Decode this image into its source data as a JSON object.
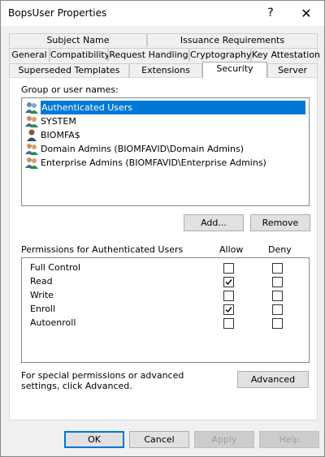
{
  "window": {
    "title": "BopsUser Properties",
    "help_glyph": "?",
    "close_glyph": "✕"
  },
  "tabs": {
    "row1": [
      "Subject Name",
      "Issuance Requirements"
    ],
    "row2": [
      "General",
      "Compatibility",
      "Request Handling",
      "Cryptography",
      "Key Attestation"
    ],
    "row3": [
      "Superseded Templates",
      "Extensions",
      "Security",
      "Server"
    ],
    "active": "Security"
  },
  "security": {
    "group_label": "Group or user names:",
    "users": [
      {
        "name": "Authenticated Users",
        "icon": "group-users-icon",
        "selected": true
      },
      {
        "name": "SYSTEM",
        "icon": "group-users-icon",
        "selected": false
      },
      {
        "name": "BIOMFA$",
        "icon": "user-icon",
        "selected": false
      },
      {
        "name": "Domain Admins (BIOMFAVID\\Domain Admins)",
        "icon": "group-users-icon",
        "selected": false
      },
      {
        "name": "Enterprise Admins (BIOMFAVID\\Enterprise Admins)",
        "icon": "group-users-icon",
        "selected": false
      }
    ],
    "add_label": "Add...",
    "remove_label": "Remove",
    "permissions_label": "Permissions for Authenticated Users",
    "allow_label": "Allow",
    "deny_label": "Deny",
    "permissions": [
      {
        "name": "Full Control",
        "allow": false,
        "deny": false
      },
      {
        "name": "Read",
        "allow": true,
        "deny": false
      },
      {
        "name": "Write",
        "allow": false,
        "deny": false
      },
      {
        "name": "Enroll",
        "allow": true,
        "deny": false
      },
      {
        "name": "Autoenroll",
        "allow": false,
        "deny": false
      }
    ],
    "advanced_text": "For special permissions or advanced settings, click Advanced.",
    "advanced_label": "Advanced"
  },
  "footer": {
    "ok_label": "OK",
    "cancel_label": "Cancel",
    "apply_label": "Apply",
    "help_label": "Help"
  },
  "colors": {
    "selection": "#0078d7",
    "check": "#000000"
  }
}
